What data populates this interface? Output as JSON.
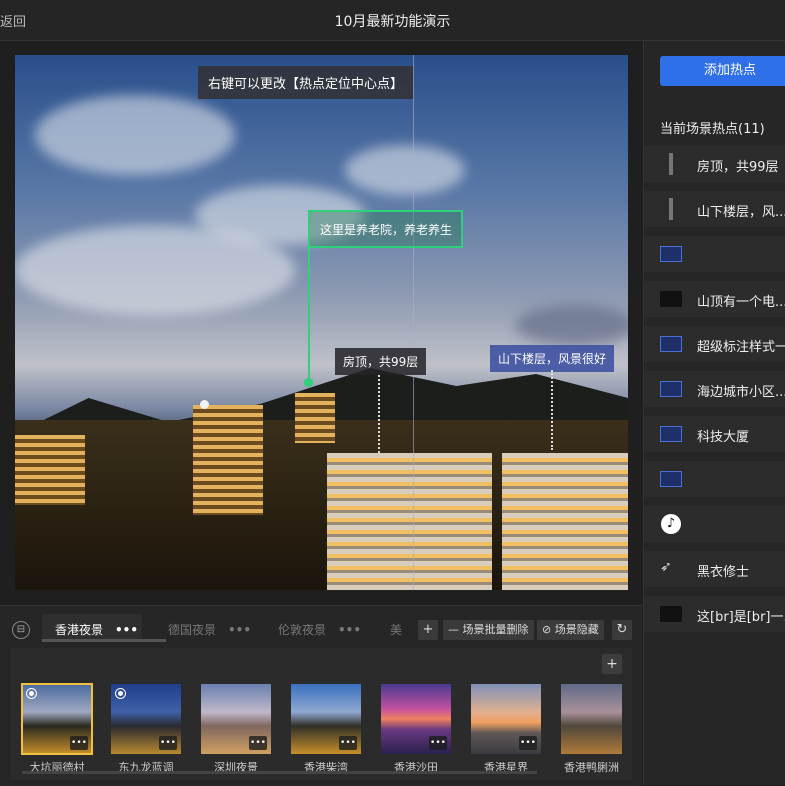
{
  "header": {
    "back_label": "返回",
    "title": "10月最新功能演示"
  },
  "viewer": {
    "tip": "右键可以更改【热点定位中心点】",
    "hotspots": [
      {
        "label": "这里是养老院，养老养生",
        "style": "green"
      },
      {
        "label": "房顶，共99层",
        "style": "dark"
      },
      {
        "label": "山下楼层，风景很好",
        "style": "blue"
      }
    ]
  },
  "right_panel": {
    "add_button": "添加热点",
    "count_label": "当前场景热点(11)",
    "items": [
      {
        "label": "房顶，共99层",
        "icon": "post-icon"
      },
      {
        "label": "山下楼层，风...",
        "icon": "post-icon"
      },
      {
        "label": "",
        "icon": "image-icon"
      },
      {
        "label": "山顶有一个电...",
        "icon": "image-icon"
      },
      {
        "label": "超级标注样式一",
        "icon": "image-icon"
      },
      {
        "label": "海边城市小区...",
        "icon": "image-icon"
      },
      {
        "label": "科技大厦",
        "icon": "image-icon"
      },
      {
        "label": "",
        "icon": "image-icon"
      },
      {
        "label": "",
        "icon": "music-icon"
      },
      {
        "label": "黑衣修士",
        "icon": "wing-icon"
      },
      {
        "label": "这[br]是[br]一...",
        "icon": "image-icon"
      }
    ]
  },
  "bottom": {
    "tabs": [
      {
        "label": "香港夜景",
        "dots": "•••",
        "active": true
      },
      {
        "label": "德国夜景",
        "dots": "•••",
        "active": false
      },
      {
        "label": "伦敦夜景",
        "dots": "•••",
        "active": false
      },
      {
        "label": "美",
        "dots": "",
        "active": false
      }
    ],
    "buttons": {
      "add": "+",
      "batch_delete": "— 场景批量删除",
      "hide": "场景隐藏",
      "refresh": "↻",
      "add_scene": "+"
    },
    "scenes": [
      {
        "label": "大坑丽德村",
        "selected": true,
        "view": true
      },
      {
        "label": "东九龙蓝调",
        "selected": false,
        "view": true
      },
      {
        "label": "深圳夜景",
        "selected": false,
        "view": false
      },
      {
        "label": "香港柴湾",
        "selected": false,
        "view": false
      },
      {
        "label": "香港沙田",
        "selected": false,
        "view": false
      },
      {
        "label": "香港星界",
        "selected": false,
        "view": false
      },
      {
        "label": "香港鸭脷洲",
        "selected": false,
        "view": false
      }
    ],
    "more_dots": "•••"
  }
}
